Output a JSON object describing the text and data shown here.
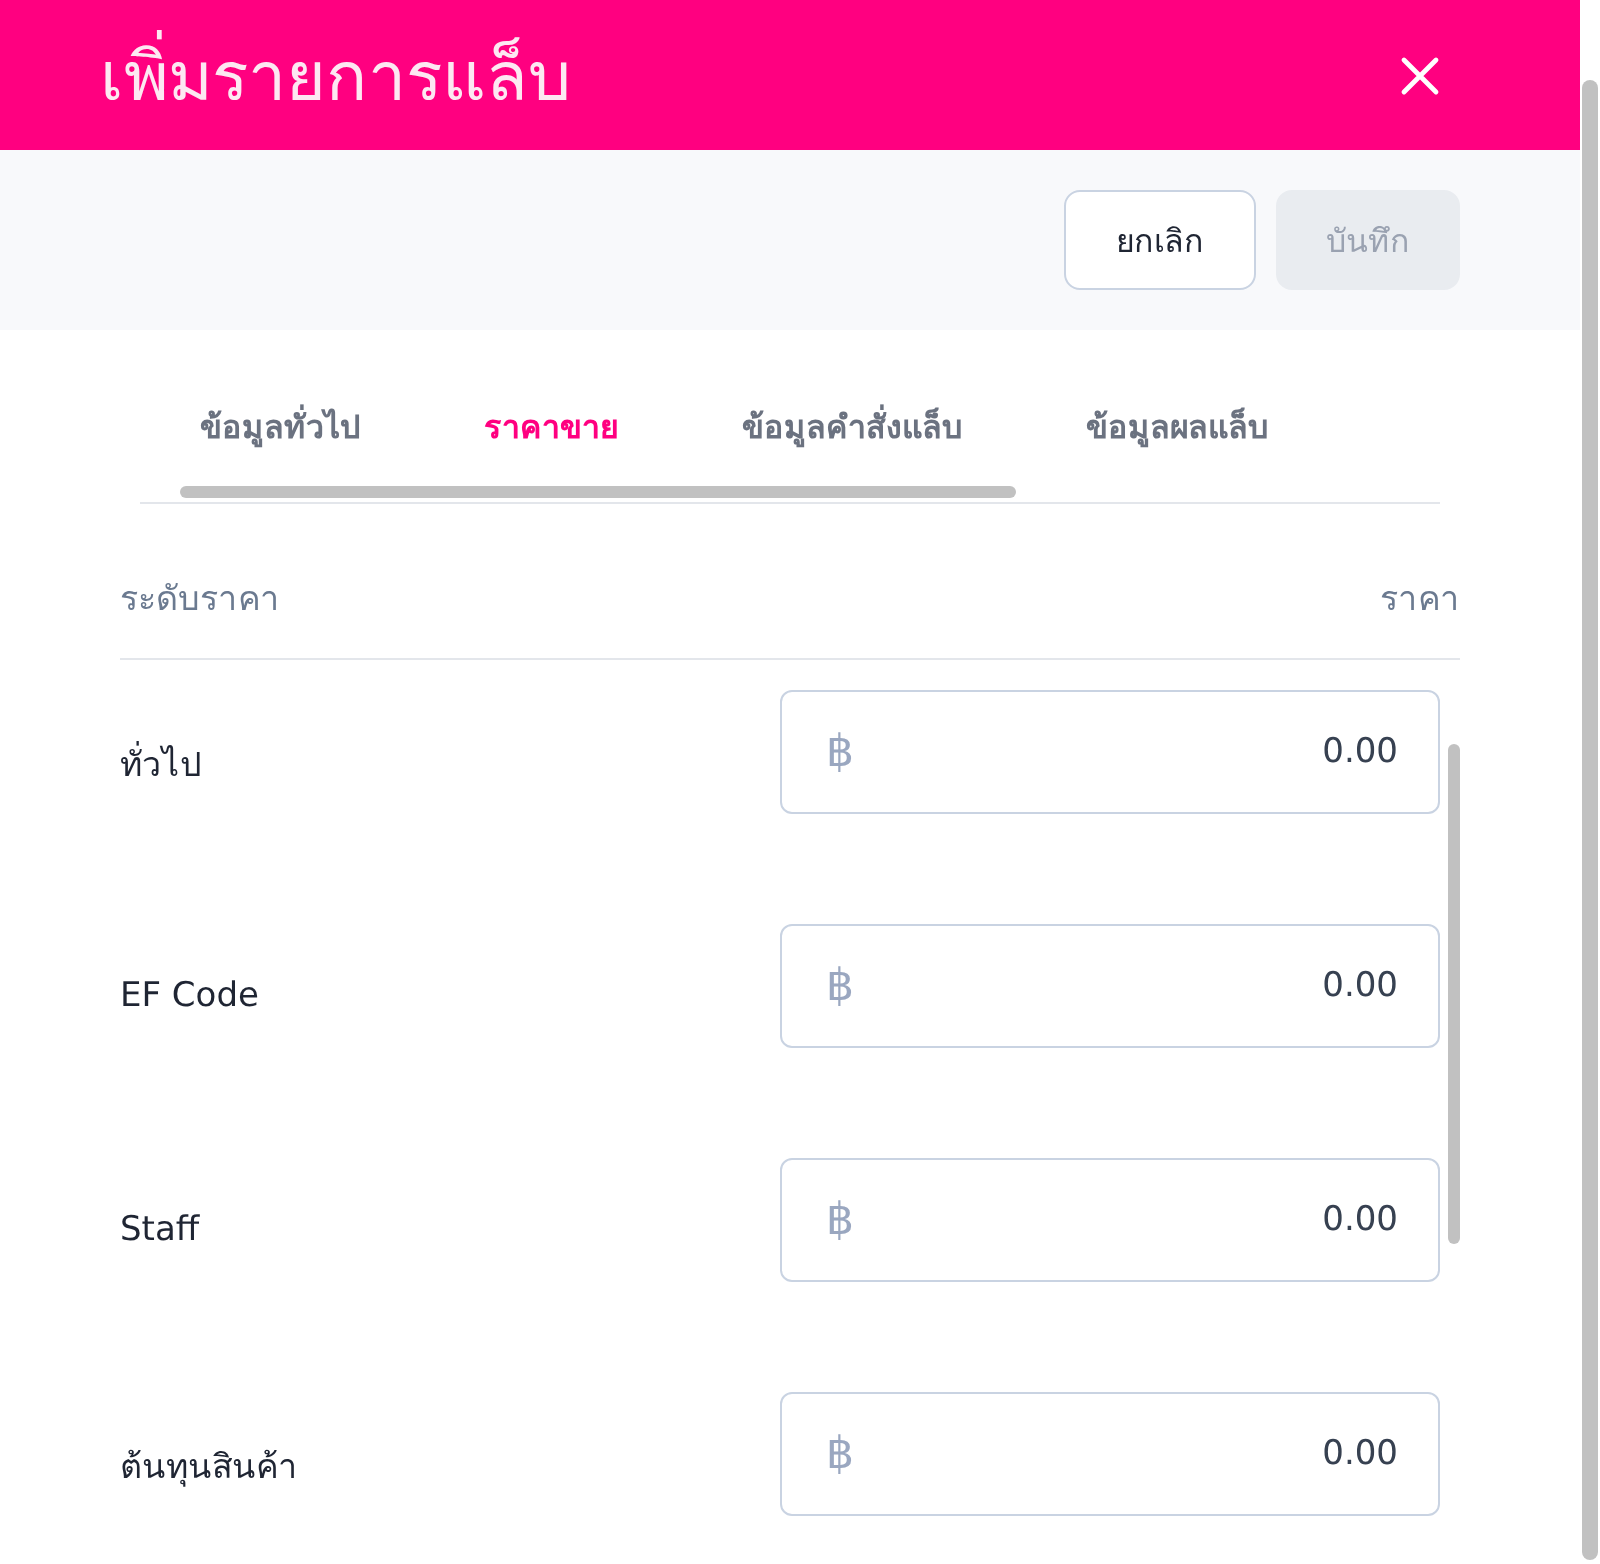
{
  "dialog": {
    "title": "เพิ่มรายการแล็บ"
  },
  "actions": [
    {
      "label": "ยกเลิก",
      "disabled": false
    },
    {
      "label": "บันทึก",
      "disabled": true
    }
  ],
  "tabs": [
    {
      "label": "ข้อมูลทั่วไป",
      "selected": false
    },
    {
      "label": "ราคาขาย",
      "selected": true
    },
    {
      "label": "ข้อมูลคำสั่งแล็บ",
      "selected": false
    },
    {
      "label": "ข้อมูลผลแล็บ",
      "selected": false
    }
  ],
  "table": {
    "columns": [
      "ระดับราคา",
      "ราคา"
    ],
    "rows": [
      {
        "label": "ทั่วไป",
        "currency": "฿",
        "value": "0.00"
      },
      {
        "label": "EF Code",
        "currency": "฿",
        "value": "0.00"
      },
      {
        "label": "Staff",
        "currency": "฿",
        "value": "0.00"
      },
      {
        "label": "ต้นทุนสินค้า",
        "currency": "฿",
        "value": "0.00"
      }
    ]
  }
}
